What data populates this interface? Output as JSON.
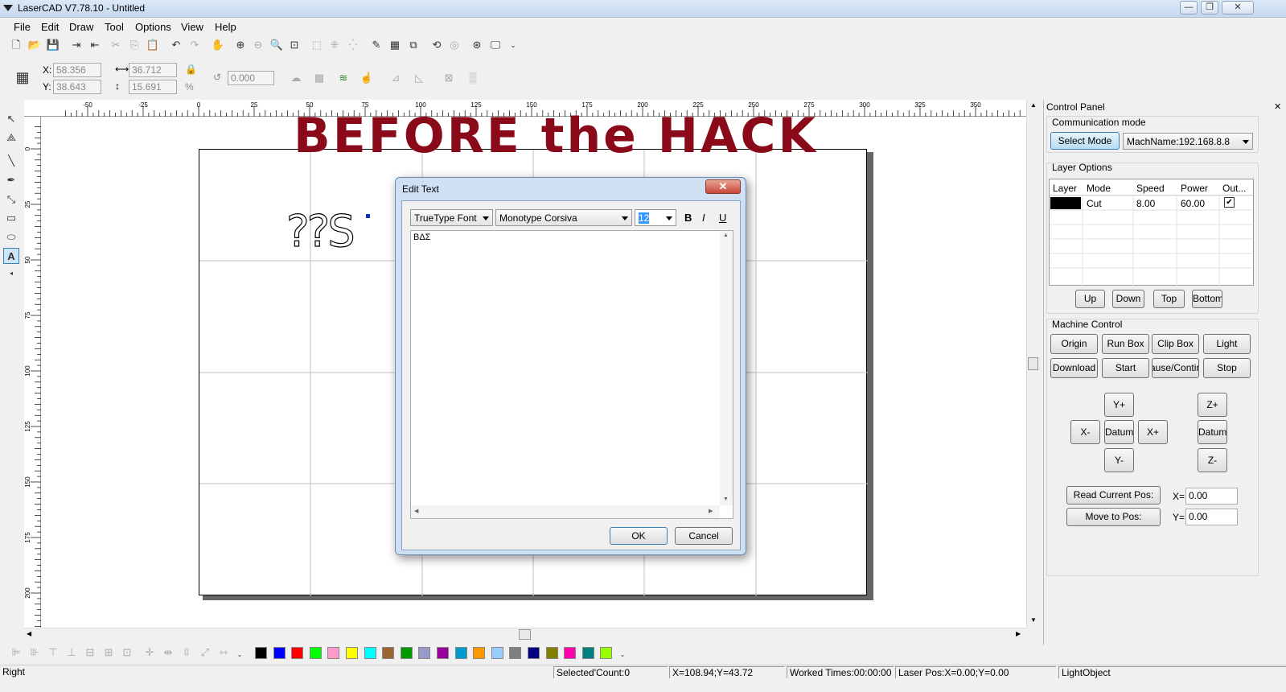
{
  "titlebar": {
    "title": "LaserCAD V7.78.10 - Untitled",
    "minimize": "—",
    "maximize": "❐",
    "close": "✕"
  },
  "menu": [
    "File",
    "Edit",
    "Draw",
    "Tool",
    "Options",
    "View",
    "Help"
  ],
  "toolbar_icons": [
    "new-icon",
    "open-icon",
    "save-icon",
    "import-icon",
    "export-icon",
    "cut-icon",
    "copy-icon",
    "paste-icon",
    "undo-icon",
    "redo-icon",
    "pan-icon",
    "zoom-in-icon",
    "zoom-out-icon",
    "zoom-window-icon",
    "zoom-fit-icon",
    "select-all-icon",
    "group-icon",
    "node-edit-icon",
    "array-icon",
    "align-icon",
    "optimize-icon",
    "machine-icon",
    "preview-icon"
  ],
  "position": {
    "x_label": "X:",
    "x_value": "58.356",
    "y_label": "Y:",
    "y_value": "38.643",
    "w_value": "36.712",
    "h_value": "15.691",
    "percent": "%",
    "rotate_value": "0.000"
  },
  "ruler": {
    "top_labels": [
      "-50",
      "-25",
      "0",
      "25",
      "50",
      "75",
      "100",
      "125",
      "150",
      "175",
      "200",
      "225",
      "250",
      "275",
      "300",
      "325",
      "350"
    ],
    "left_labels": [
      "0",
      "25",
      "50",
      "75",
      "100",
      "125",
      "150",
      "175",
      "200"
    ]
  },
  "overlay": {
    "headline": "BEFORE the HACK",
    "canvas_text": "??S"
  },
  "dialog": {
    "title": "Edit Text",
    "font_type": "TrueType Font",
    "font_name": "Monotype Corsiva",
    "font_size": "12",
    "bold": "B",
    "italic": "I",
    "underline": "U",
    "text_content": "BΔΣ",
    "ok": "OK",
    "cancel": "Cancel"
  },
  "control_panel": {
    "title": "Control Panel",
    "close": "✕",
    "comm_mode_label": "Communication mode",
    "select_mode": "Select Mode",
    "machine": "MachName:192.168.8.8",
    "layer_options_label": "Layer Options",
    "layer_headers": [
      "Layer",
      "Mode",
      "Speed",
      "Power",
      "Out..."
    ],
    "layer_rows": [
      {
        "layer_color": "#000000",
        "mode": "Cut",
        "speed": "8.00",
        "power": "60.00",
        "out": "✔"
      }
    ],
    "layer_buttons": [
      "Up",
      "Down",
      "Top",
      "Bottom"
    ],
    "machine_control_label": "Machine Control",
    "mc_row1": [
      "Origin",
      "Run Box",
      "Clip Box",
      "Light"
    ],
    "mc_row2": [
      "Download",
      "Start",
      "Pause/Continue",
      "Stop"
    ],
    "jog": {
      "yplus": "Y+",
      "yminus": "Y-",
      "xminus": "X-",
      "xplus": "X+",
      "datum": "Datum",
      "zplus": "Z+",
      "zminus": "Z-",
      "zdatum": "Datum"
    },
    "read_pos": "Read Current Pos:",
    "move_pos": "Move to Pos:",
    "x_label": "X=",
    "x_value": "0.00",
    "y_label": "Y=",
    "y_value": "0.00"
  },
  "palette": [
    "#000000",
    "#0000ff",
    "#ff0000",
    "#00ff00",
    "#ff99cc",
    "#ffff00",
    "#00ffff",
    "#996633",
    "#009900",
    "#9999cc",
    "#990099",
    "#0099cc",
    "#ff9900",
    "#99ccff",
    "#808080",
    "#000080",
    "#808000",
    "#ff00aa",
    "#008080",
    "#99ff00"
  ],
  "status": {
    "left": "Right",
    "selected": "Selected'Count:0",
    "coords": "X=108.94;Y=43.72",
    "worked": "Worked Times:00:00:00",
    "laser_pos": "Laser Pos:X=0.00;Y=0.00",
    "vendor": "LightObject"
  },
  "colors": {
    "headline": "#8b0a1a",
    "titlebar": "#c5d9ef",
    "selected_button": "#b9dcf3"
  }
}
